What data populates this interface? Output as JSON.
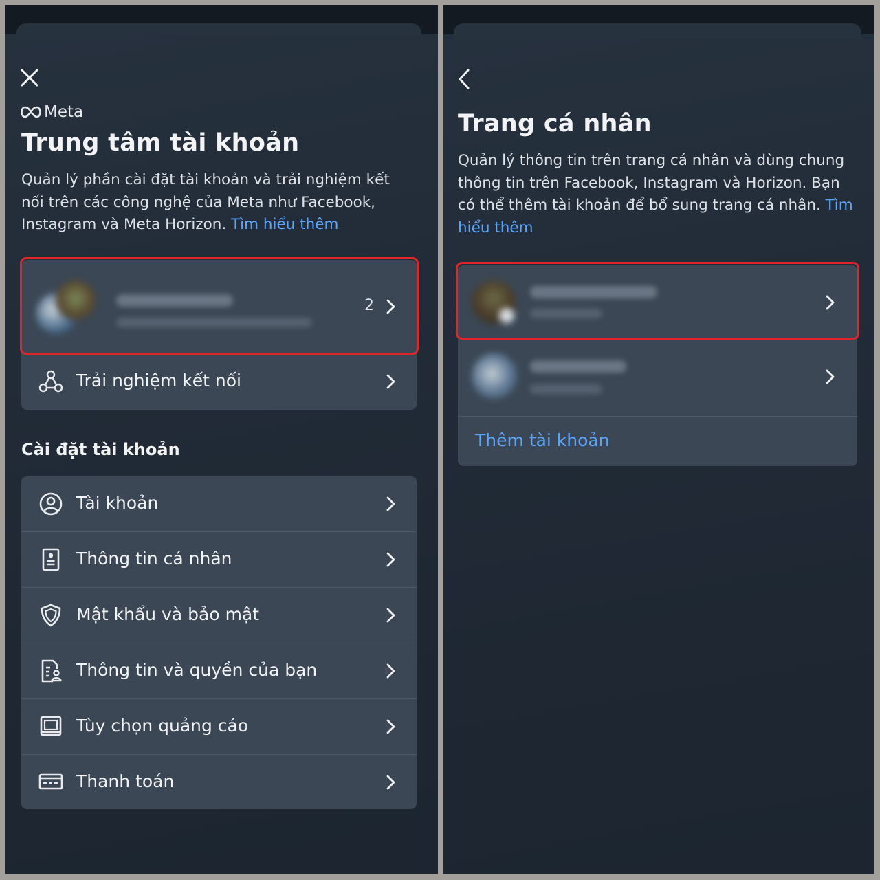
{
  "left_screen": {
    "meta_logo": "Meta",
    "title": "Trung tâm tài khoản",
    "description": "Quản lý phần cài đặt tài khoản và trải nghiệm kết nối trên các công nghệ của Meta như Facebook, Instagram và Meta Horizon.",
    "learn_more": "Tìm hiểu thêm",
    "profiles_row": {
      "count": "2"
    },
    "connected_experiences": "Trải nghiệm kết nối",
    "section_title": "Cài đặt tài khoản",
    "settings": [
      {
        "label": "Tài khoản",
        "icon": "person-circle-icon"
      },
      {
        "label": "Thông tin cá nhân",
        "icon": "id-card-icon"
      },
      {
        "label": "Mật khẩu và bảo mật",
        "icon": "shield-icon"
      },
      {
        "label": "Thông tin và quyền của bạn",
        "icon": "document-person-icon"
      },
      {
        "label": "Tùy chọn quảng cáo",
        "icon": "monitor-icon"
      },
      {
        "label": "Thanh toán",
        "icon": "credit-card-icon"
      }
    ]
  },
  "right_screen": {
    "title": "Trang cá nhân",
    "description": "Quản lý thông tin trên trang cá nhân và dùng chung thông tin trên Facebook, Instagram và Horizon. Bạn có thể thêm tài khoản để bổ sung trang cá nhân.",
    "learn_more": "Tìm hiểu thêm",
    "add_account": "Thêm tài khoản"
  },
  "colors": {
    "highlight": "#e0262b",
    "link": "#5aa6ff",
    "card": "#3b4754"
  }
}
